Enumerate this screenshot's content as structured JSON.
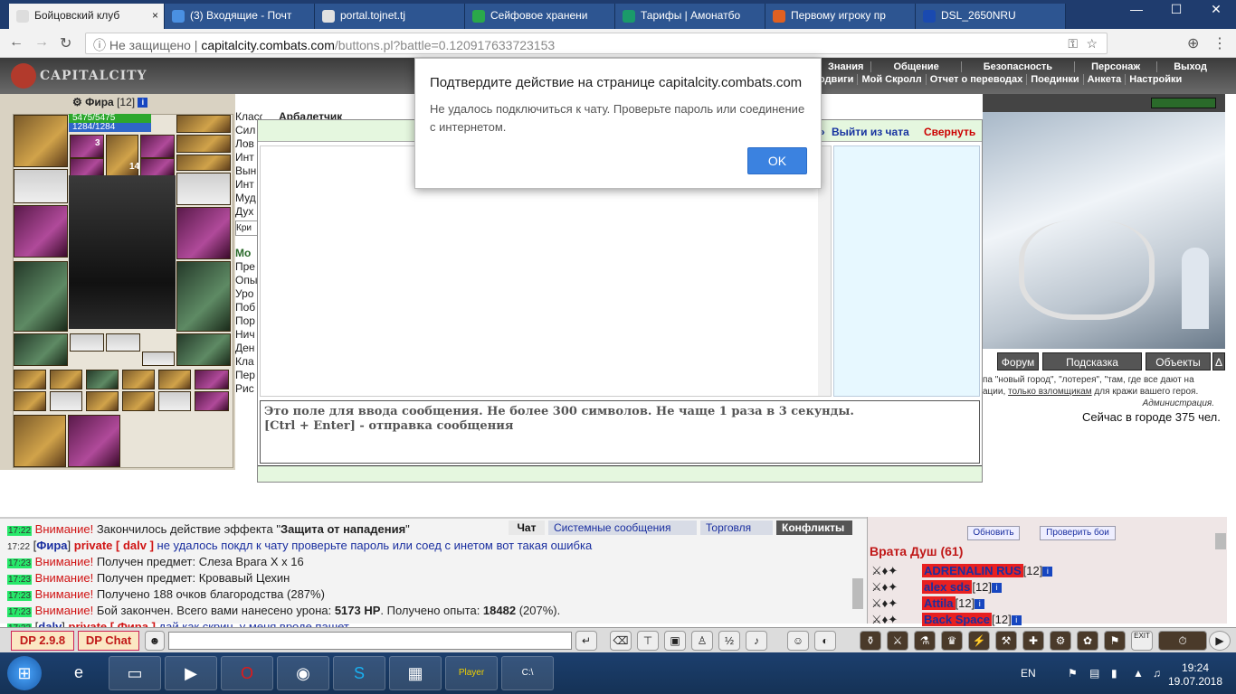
{
  "browser": {
    "tabs": [
      {
        "title": "Бойцовский клуб",
        "color": "#ffffff",
        "active": true
      },
      {
        "title": "(3) Входящие - Почт",
        "color": "#4a90e2"
      },
      {
        "title": "portal.tojnet.tj",
        "color": "#e0e0e0"
      },
      {
        "title": "Сейфовое хранени",
        "color": "#2aa84a"
      },
      {
        "title": "Тарифы | Амонатбо",
        "color": "#1a9a6a"
      },
      {
        "title": "Первому игроку пр",
        "color": "#e06020"
      },
      {
        "title": "DSL_2650NRU",
        "color": "#1a4ab0"
      }
    ],
    "tab_close": "×",
    "back": "←",
    "forward": "→",
    "reload": "↻",
    "info_glyph": "ⓘ",
    "not_secure": "Не защищено",
    "url_domain": "capitalcity.combats.com",
    "url_path": "/buttons.pl?battle=0.120917633723153",
    "win_min": "—",
    "win_max": "☐",
    "win_close": "✕"
  },
  "game_header": {
    "logo": "CAPITALCITY",
    "menu1": [
      "Знания",
      "Общение",
      "Безопасность",
      "Персонаж",
      "Выход"
    ],
    "menu2": [
      "одвиги",
      "Мой Скролл",
      "Отчет о переводах",
      "Поединки",
      "Анкета",
      "Настройки"
    ]
  },
  "character": {
    "name": "Фира",
    "level": "[12]",
    "info": "i",
    "hp": "5475/5475",
    "mp": "1284/1284",
    "badge1": "3",
    "badge2": "14",
    "class_label": "Класс:",
    "class_value": "Арбалетчик",
    "stat_stubs": [
      "Сил",
      "Лов",
      "Инт",
      "Вын",
      "Инт",
      "Муд",
      "Дух"
    ],
    "stat_button": "Кри",
    "stat_stubs2_head": "Мо",
    "stat_stubs2": [
      "Пре",
      "Опы",
      "Уро",
      "Поб",
      "Пор",
      "Нич",
      "Ден",
      "Кла",
      "Пер",
      "Рис"
    ]
  },
  "chat_window": {
    "exit_label": "Выйти из чата",
    "collapse_label": "Свернуть",
    "hint_line1": "Это поле для ввода сообщения. Не более 300 символов. Не чаще 1 раза в 3 секунды.",
    "hint_line2": "[Ctrl + Enter] - отправка сообщения"
  },
  "dialog": {
    "title": "Подтвердите действие на странице capitalcity.combats.com",
    "message": "Не удалось подключиться к чату. Проверьте пароль или соединение с интернетом.",
    "ok": "OK"
  },
  "right_panel": {
    "buttons": [
      "Форум",
      "Подсказка",
      "Объекты",
      "Δ"
    ],
    "news1": "па \"новый город\", \"лотерея\", \"там, где все дают на",
    "news2_pre": "ации, ",
    "news2_link": "только взломщикам",
    "news2_post": " для кражи вашего героя.",
    "news3": "Администрация.",
    "online": "Сейчас в городе 375 чел."
  },
  "log": {
    "tabs": [
      "Чат",
      "Системные сообщения",
      "Торговля",
      "Конфликты"
    ],
    "lines": [
      {
        "time": "17:22",
        "hl": true,
        "kind": "warn",
        "label": "Внимание!",
        "text": " Закончилось действие эффекта \"",
        "bold": "Защита от нападения",
        "tail": "\""
      },
      {
        "time": "17:22",
        "hl": false,
        "kind": "priv",
        "nick": "Фира",
        "priv": "private [ dalv ]",
        "text": " не удалось покдл к чату проверьте пароль или соед с инетом вот такая ошибка"
      },
      {
        "time": "17:23",
        "hl": true,
        "kind": "warn",
        "label": "Внимание!",
        "text": " Получен предмет: Слеза Врага X x 16"
      },
      {
        "time": "17:23",
        "hl": true,
        "kind": "warn",
        "label": "Внимание!",
        "text": " Получен предмет: Кровавый Цехин"
      },
      {
        "time": "17:23",
        "hl": true,
        "kind": "warn",
        "label": "Внимание!",
        "text": " Получено 188 очков благородства (287%)"
      },
      {
        "time": "17:23",
        "hl": true,
        "kind": "warn",
        "label": "Внимание!",
        "text": " Бой закончен. Всего вами нанесено урона: ",
        "b1": "5173 HP",
        "mid": ". Получено опыта: ",
        "b2": "18482",
        "tail": " (207%)."
      },
      {
        "time": "17:23",
        "hl": true,
        "kind": "priv",
        "nick": "dalv",
        "priv": "private [ Фира ]",
        "text": " дай как скрин, у меня вроде пашет"
      }
    ]
  },
  "room": {
    "refresh": "Обновить",
    "check_fights": "Проверить бои",
    "name": "Врата Душ (61)",
    "users": [
      {
        "name": "ADRENALIN RUS",
        "level": "[12]"
      },
      {
        "name": "alex sds",
        "level": "[12]"
      },
      {
        "name": "Attila",
        "level": "[12]"
      },
      {
        "name": "Back Space",
        "level": "[12]"
      }
    ]
  },
  "toolbar": {
    "dp_version": "DP 2.9.8",
    "dp_chat": "DP Chat",
    "exit": "EXIT"
  },
  "taskbar": {
    "lang": "EN",
    "time": "19:24",
    "date": "19.07.2018",
    "player_label": "Player"
  }
}
